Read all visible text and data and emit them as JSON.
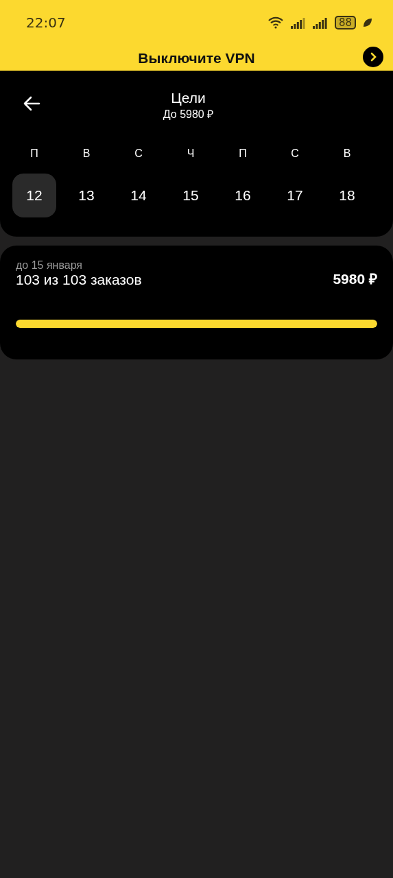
{
  "status_bar": {
    "time": "22:07",
    "battery": "88"
  },
  "banner": {
    "text": "Выключите VPN"
  },
  "header": {
    "title": "Цели",
    "subtitle": "До 5980 ₽"
  },
  "week": [
    {
      "weekday": "П",
      "date": "12",
      "selected": true
    },
    {
      "weekday": "В",
      "date": "13",
      "selected": false
    },
    {
      "weekday": "С",
      "date": "14",
      "selected": false
    },
    {
      "weekday": "Ч",
      "date": "15",
      "selected": false
    },
    {
      "weekday": "П",
      "date": "16",
      "selected": false
    },
    {
      "weekday": "С",
      "date": "17",
      "selected": false
    },
    {
      "weekday": "В",
      "date": "18",
      "selected": false
    }
  ],
  "goal": {
    "deadline": "до 15 января",
    "progress_text": "103 из 103 заказов",
    "amount": "5980 ₽",
    "level": 1
  }
}
